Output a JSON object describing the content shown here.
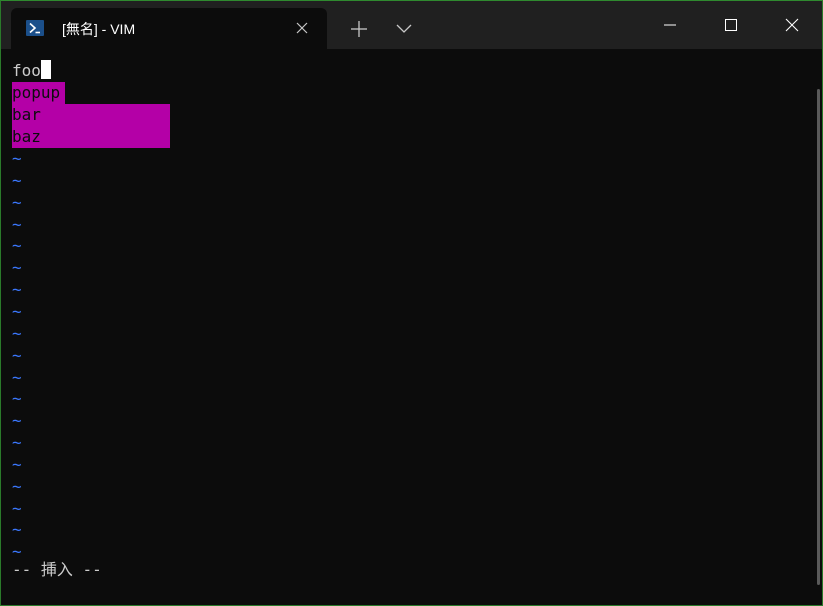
{
  "window": {
    "tab_title": "[無名] - VIM",
    "accent_color": "#2f8a2f"
  },
  "editor": {
    "current_line": "foo",
    "popup_menu": {
      "items": [
        "popup",
        "bar",
        "baz"
      ],
      "background_color": "#b400a7"
    },
    "empty_line_marker": "~",
    "empty_line_count": 19,
    "empty_line_color": "#3b78ff",
    "mode_text": "-- 挿入 --"
  },
  "icons": {
    "tab": "powershell-icon",
    "tab_close": "close-icon",
    "new_tab": "plus-icon",
    "dropdown": "chevron-down-icon",
    "minimize": "minimize-icon",
    "maximize": "maximize-icon",
    "close_window": "close-icon"
  }
}
